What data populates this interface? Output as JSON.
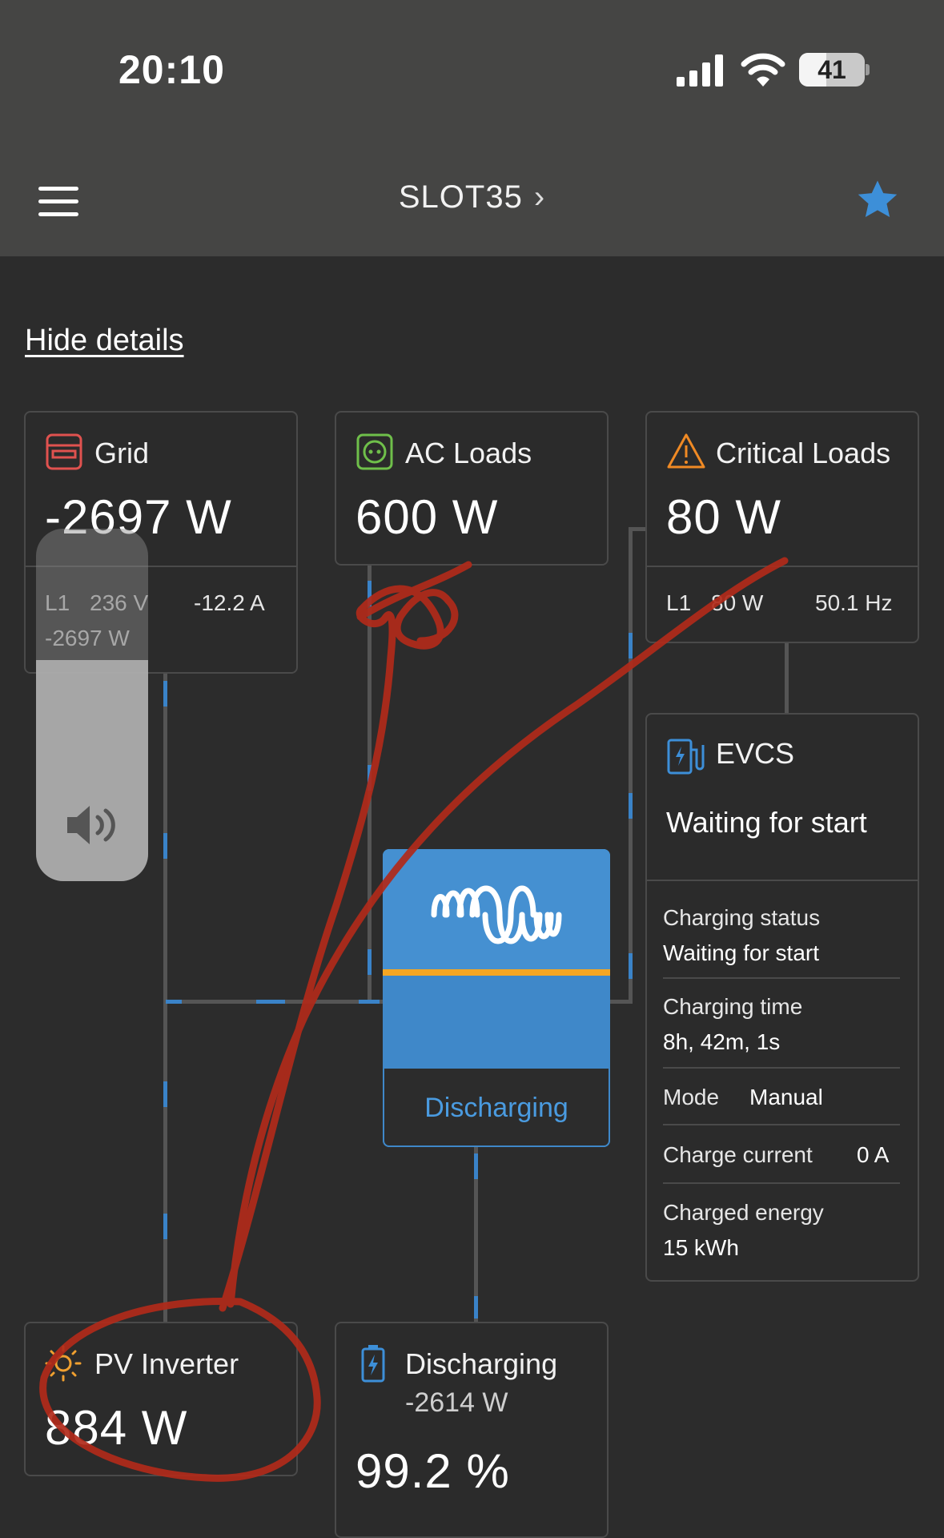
{
  "status_bar": {
    "time": "20:10",
    "battery_percent": "41"
  },
  "nav": {
    "site_name": "SLOT35",
    "chevron": "›"
  },
  "hide_details_label": "Hide details",
  "grid": {
    "title": "Grid",
    "power": "-2697 W",
    "phase": "L1",
    "voltage": "236 V",
    "current": "-12.2 A",
    "phase_power": "-2697 W"
  },
  "ac_loads": {
    "title": "AC Loads",
    "power": "600 W"
  },
  "critical_loads": {
    "title": "Critical Loads",
    "power": "80 W",
    "phase": "L1",
    "phase_power": "80 W",
    "frequency": "50.1 Hz"
  },
  "evcs": {
    "title": "EVCS",
    "status": "Waiting for start",
    "charging_status_label": "Charging status",
    "charging_status_value": "Waiting for start",
    "charging_time_label": "Charging time",
    "charging_time_value": "8h, 42m, 1s",
    "mode_label": "Mode",
    "mode_value": "Manual",
    "charge_current_label": "Charge current",
    "charge_current_value": "0 A",
    "charged_energy_label": "Charged energy",
    "charged_energy_value": "15 kWh"
  },
  "inverter": {
    "state": "Discharging"
  },
  "pv_inverter": {
    "title": "PV Inverter",
    "power": "884 W"
  },
  "battery": {
    "state": "Discharging",
    "power": "-2614 W",
    "soc": "99.2 %"
  },
  "colors": {
    "flow_blue": "#3a83c8",
    "grid_icon": "#e0524f",
    "ac_loads_icon": "#6fbf4a",
    "critical_icon": "#f08a24",
    "star": "#3d8fd8",
    "annotation_red": "#b12a1a"
  }
}
